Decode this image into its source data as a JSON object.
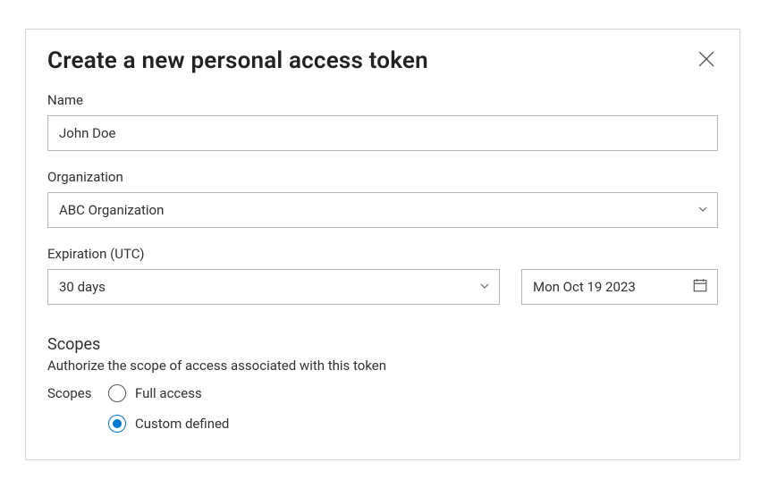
{
  "dialog": {
    "title": "Create a new personal access token"
  },
  "fields": {
    "name": {
      "label": "Name",
      "value": "John Doe"
    },
    "organization": {
      "label": "Organization",
      "value": "ABC Organization"
    },
    "expiration": {
      "label": "Expiration (UTC)",
      "duration_value": "30 days",
      "date_value": "Mon Oct 19 2023"
    }
  },
  "scopes": {
    "section_title": "Scopes",
    "description": "Authorize the scope of access associated with this token",
    "group_label": "Scopes",
    "options": {
      "full": "Full access",
      "custom": "Custom defined"
    },
    "selected": "custom"
  }
}
